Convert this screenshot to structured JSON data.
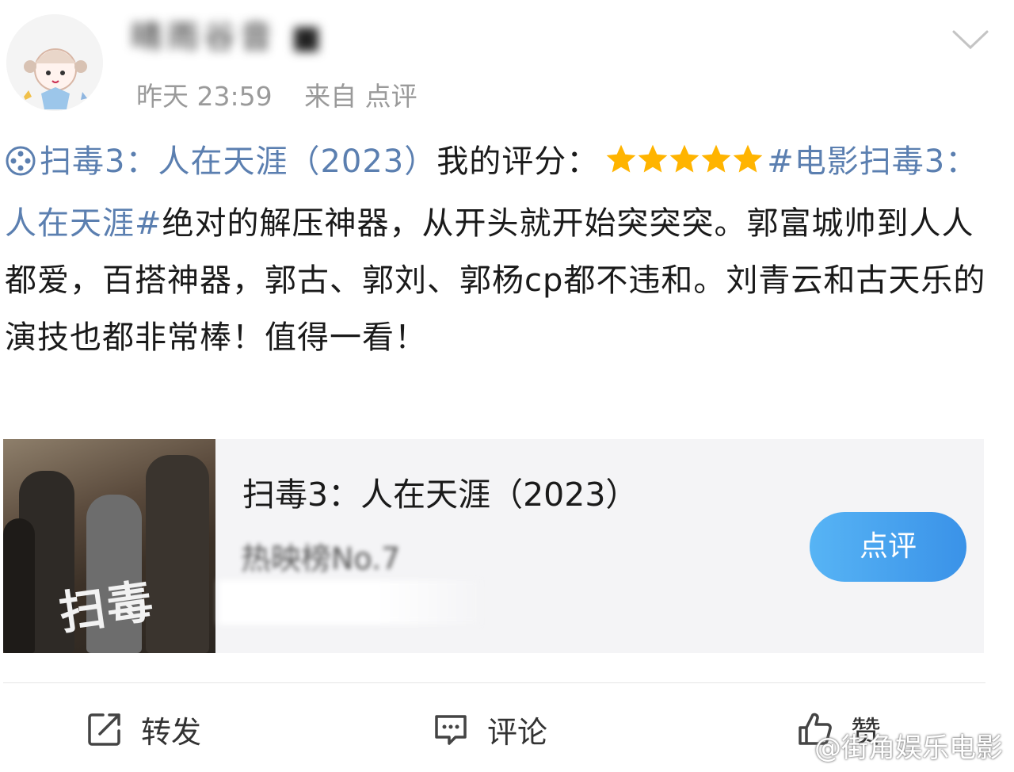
{
  "post": {
    "timestamp": "昨天 23:59",
    "source": "来自 点评"
  },
  "content": {
    "movie_link": "扫毒3：人在天涯（2023）",
    "rating_label": "我的评分：",
    "rating": 5,
    "rating_max": 5,
    "hashtag": "#电影扫毒3：人在天涯#",
    "body": "绝对的解压神器，从开头就开始突突突。郭富城帅到人人都爱，百搭神器，郭古、郭刘、郭杨cp都不违和。刘青云和古天乐的演技也都非常棒！值得一看！"
  },
  "card": {
    "title": "扫毒3：人在天涯（2023）",
    "poster_text": "扫毒",
    "button_label": "点评"
  },
  "actions": {
    "repost_label": "转发",
    "comment_label": "评论",
    "like_label": "赞"
  },
  "watermark": "@街角娱乐电影",
  "colors": {
    "link": "#5b7fb0",
    "star": "#ffb400",
    "button_start": "#57b4f5",
    "button_end": "#3a92e8"
  },
  "icons": [
    "film-reel-icon",
    "star-icon",
    "chevron-down-icon",
    "repost-icon",
    "comment-icon",
    "like-icon"
  ]
}
